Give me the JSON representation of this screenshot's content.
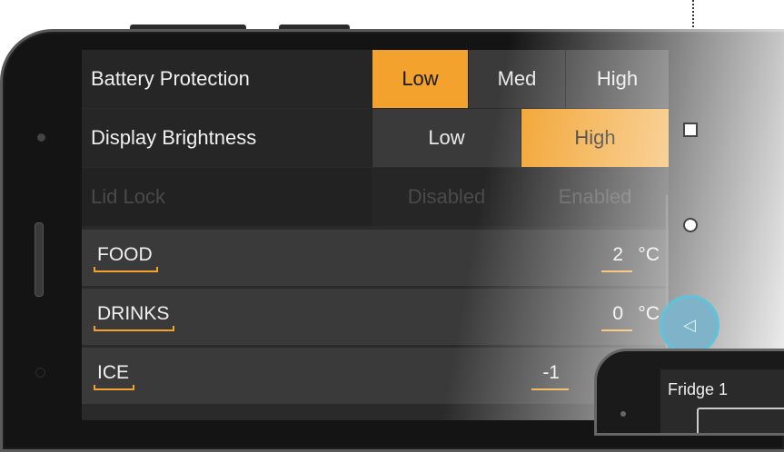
{
  "settings": [
    {
      "label": "Battery Protection",
      "options": [
        "Low",
        "Med",
        "High"
      ],
      "selected": "Low",
      "enabled": true
    },
    {
      "label": "Display Brightness",
      "options": [
        "Low",
        "High"
      ],
      "selected": "High",
      "enabled": true
    },
    {
      "label": "Lid Lock",
      "options": [
        "Disabled",
        "Enabled"
      ],
      "selected": null,
      "enabled": false
    }
  ],
  "temperatures": [
    {
      "zone": "FOOD",
      "value": "2",
      "unit": "°C"
    },
    {
      "zone": "DRINKS",
      "value": "0",
      "unit": "°C"
    },
    {
      "zone": "ICE",
      "value": "-1",
      "unit": ""
    }
  ],
  "second_device": {
    "title": "Fridge 1"
  },
  "icons": {
    "back": "back-triangle-icon"
  },
  "colors": {
    "accent": "#f2a22d",
    "background": "#2a2a2a",
    "highlight_ring": "#5fc3dc"
  }
}
